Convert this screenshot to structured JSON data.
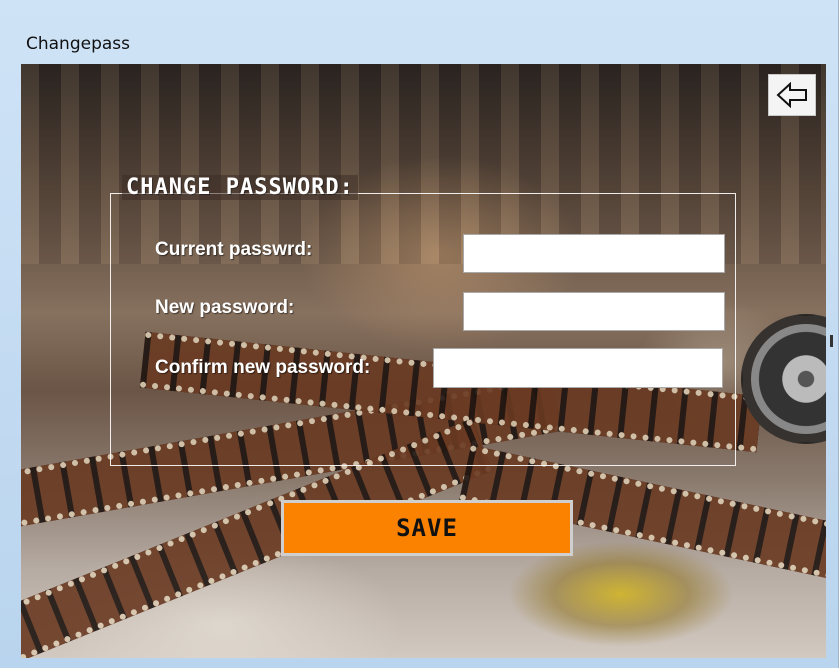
{
  "window": {
    "title": "Changepass"
  },
  "nav": {
    "back_icon": "arrow-left-icon"
  },
  "form": {
    "group_title": "CHANGE PASSWORD:",
    "fields": [
      {
        "label": "Current passwrd:",
        "value": "",
        "placeholder": ""
      },
      {
        "label": "New password:",
        "value": "",
        "placeholder": ""
      },
      {
        "label": "Confirm new password:",
        "value": "",
        "placeholder": ""
      }
    ],
    "save_label": "SAVE"
  },
  "colors": {
    "save_button": "#fa8200",
    "text_light": "#ffffff"
  }
}
